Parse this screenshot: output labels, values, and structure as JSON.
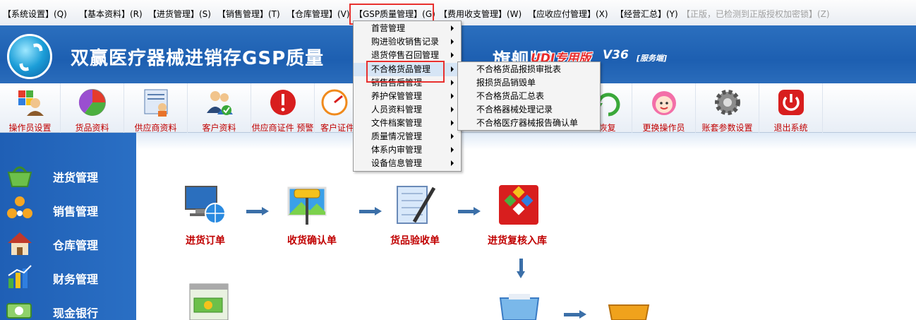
{
  "menubar": {
    "items": [
      {
        "label": "【系统设置】(Q)"
      },
      {
        "label": "【基本资料】(R)"
      },
      {
        "label": "【进货管理】(S)"
      },
      {
        "label": "【销售管理】(T)"
      },
      {
        "label": "【仓库管理】(V)"
      },
      {
        "label": "【GSP质量管理】(G)"
      },
      {
        "label": "【费用收支管理】(W)"
      },
      {
        "label": "【应收应付管理】(X)"
      },
      {
        "label": "【经营汇总】(Y)"
      },
      {
        "label": "【正版，已检测到正版授权加密锁】(Z)"
      }
    ]
  },
  "header": {
    "title": "双赢医疗器械进销存GSP质量",
    "title_suffix": "旗舰版）",
    "udi_label": "UDI专用版",
    "version": "V36",
    "server_label": "[服务端]"
  },
  "toolbar": {
    "items": [
      {
        "label": "操作员设置",
        "icon": "users-icon"
      },
      {
        "label": "货品资料",
        "icon": "pie-chart-icon"
      },
      {
        "label": "供应商资料",
        "icon": "supplier-card-icon"
      },
      {
        "label": "客户资料",
        "icon": "customers-icon"
      },
      {
        "label": "供应商证件 预警",
        "icon": "warning-icon"
      },
      {
        "label": "客户证件",
        "icon": "gauge-icon"
      },
      {
        "label": "恢复",
        "icon": "restore-icon"
      },
      {
        "label": "更换操作员",
        "icon": "avatar-icon"
      },
      {
        "label": "账套参数设置",
        "icon": "gear-icon"
      },
      {
        "label": "退出系统",
        "icon": "power-icon"
      }
    ]
  },
  "sidebar": {
    "items": [
      {
        "label": "进货管理",
        "icon": "basket-icon"
      },
      {
        "label": "销售管理",
        "icon": "arrows-icon"
      },
      {
        "label": "仓库管理",
        "icon": "house-icon"
      },
      {
        "label": "财务管理",
        "icon": "finance-icon"
      },
      {
        "label": "现金银行",
        "icon": "cash-icon"
      }
    ]
  },
  "flow": {
    "items": [
      {
        "label": "进货订单",
        "icon": "monitor-globe-icon"
      },
      {
        "label": "收货确认单",
        "icon": "paint-roller-icon"
      },
      {
        "label": "货品验收单",
        "icon": "blueprint-icon"
      },
      {
        "label": "进货复核入库",
        "icon": "diamond-box-icon"
      }
    ]
  },
  "dropdown": {
    "items": [
      {
        "label": "首营管理"
      },
      {
        "label": "购进验收销售记录"
      },
      {
        "label": "退货停售召回管理"
      },
      {
        "label": "不合格货品管理"
      },
      {
        "label": "销售售后管理"
      },
      {
        "label": "养护保管管理"
      },
      {
        "label": "人员资料管理"
      },
      {
        "label": "文件档案管理"
      },
      {
        "label": "质量情况管理"
      },
      {
        "label": "体系内审管理"
      },
      {
        "label": "设备信息管理"
      }
    ]
  },
  "submenu": {
    "items": [
      {
        "label": "不合格货品报损审批表"
      },
      {
        "label": "报损货品销毁单"
      },
      {
        "label": "不合格货品汇总表"
      },
      {
        "label": "不合格器械处理记录"
      },
      {
        "label": "不合格医疗器械报告确认单"
      }
    ]
  },
  "colors": {
    "accent": "#1d5fb1",
    "highlight_box": "#e8312f",
    "label_red": "#c00000"
  }
}
